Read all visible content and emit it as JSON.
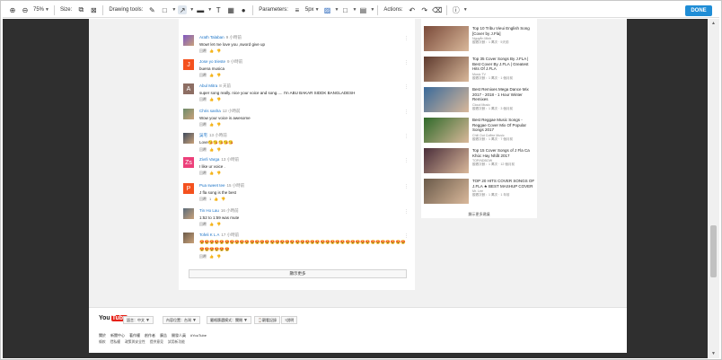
{
  "toolbar": {
    "zoom": "75%",
    "size_label": "Size:",
    "drawing_label": "Drawing tools:",
    "params_label": "Parameters:",
    "stroke": "5px",
    "actions_label": "Actions:",
    "done": "DONE"
  },
  "comments": [
    {
      "name": "Arath Talaban",
      "time": "9 小時前",
      "text": "Wow! let me love you ,sword give up",
      "avatar_color": "#7e57c2",
      "avatar_letter": "",
      "photo": true
    },
    {
      "name": "Jose yo trieste",
      "time": "9 小時前",
      "text": "buena musica",
      "avatar_color": "#f4511e",
      "avatar_letter": "J",
      "photo": false
    },
    {
      "name": "Abul Mitra",
      "time": "8 天前",
      "text": "super song really. nice your voice and song..... I'm ABU BAKAR SIDDK BANGLADESH",
      "avatar_color": "#8d6e63",
      "avatar_letter": "A",
      "photo": false
    },
    {
      "name": "Chris sasha",
      "time": "12 小時前",
      "text": "Wow your voice is awesome",
      "avatar_color": "#6d8b6a",
      "avatar_letter": "",
      "photo": true
    },
    {
      "name": "吳宅",
      "time": "13 小時前",
      "text": "Love😘😘😘😘😘",
      "avatar_color": "#3e4a5c",
      "avatar_letter": "",
      "photo": true
    },
    {
      "name": "Zivrli Varga",
      "time": "13 小時前",
      "text": "I like ur voice .",
      "avatar_color": "#ec407a",
      "avatar_letter": "Zs",
      "photo": false
    },
    {
      "name": "Pua sweet tee",
      "time": "15 小時前",
      "text": "J fla song is the best",
      "avatar_color": "#f4511e",
      "avatar_letter": "P",
      "photo": false
    },
    {
      "name": "Tin Ho Lau",
      "time": "16 小時前",
      "text": "1:52 to 1:59 was mute",
      "avatar_color": "#5a6b7a",
      "avatar_letter": "",
      "photo": true
    },
    {
      "name": "Tofeli K L A",
      "time": "17 小時前",
      "text": "😍😍😍😍😍😍😍😍😍😍😍😍😍😍😍😍😍😍😍😍😍😍😍😍😍😍😍😍😍😍😍😍😍😍😍😍😍😍😍😍😍😍😍😍😍😍😍😍😍",
      "text2": "😍😍😍😍😍😍",
      "avatar_color": "#6b5a4a",
      "avatar_letter": "",
      "photo": true
    }
  ],
  "comment_actions": {
    "reply": "回覆",
    "like_count": "1"
  },
  "more_comments": "顯示更多",
  "related": [
    {
      "title": "Top 10 Tribu Vieui English Song [Cover by J.Fla]",
      "channel": "Nguyễn Minh",
      "views": "觀看次數：1 萬次 · 5天前",
      "thumb": "#7a4a3a"
    },
    {
      "title": "Top 35 Cover Songs By J.FLA | Best Cover By J.FLA | Greatest Hits Of J.FLA",
      "channel": "Music TV",
      "views": "觀看次數：1 萬次 · 1 個月前",
      "thumb": "#5e3a2e"
    },
    {
      "title": "Best Remixes Mega Dance Mix 2017 - 2018 - 1 Hour Winter Remixes",
      "channel": "Cloud Music",
      "views": "觀看次數：1 萬次 · 3 個月前",
      "thumb": "#3a6a9a"
    },
    {
      "title": "Best Reggae Music Songs - Reggae Cover Mix Of Popular Songs 2017",
      "channel": "Chill Out Coffee Music",
      "views": "觀看次數：1 萬次 · 7 個月前",
      "thumb": "#2f6a2a"
    },
    {
      "title": "Top 15 Cover Songs of J Fla Ca Khúc Hay Nhất 2017",
      "channel": "TOP/NDBOW",
      "views": "觀看次數：1 萬次 · 12 個月前",
      "thumb": "#4a2e3a"
    },
    {
      "title": "TOP 20 HITS COVER SONGS OF J.FLA ★ BEST MASHUP COVER",
      "channel": "Mr. Lee",
      "views": "觀看次數：1 萬次 · 1 年前",
      "thumb": "#6a5a4a"
    }
  ],
  "related_more": "顯示更多建議",
  "footer": {
    "logo_you": "You",
    "logo_tube": "Tube",
    "language": "語言：中文",
    "location": "內容位置：台灣",
    "restricted": "嚴格篩選模式：關閉",
    "history": "觀看記錄",
    "help": "說明",
    "links1": [
      "關於",
      "新聞中心",
      "著作權",
      "創作者",
      "廣告",
      "開發人員",
      "#YouTube"
    ],
    "links2": [
      "條款",
      "隱私權",
      "政策與安全性",
      "提供意見",
      "試用新功能"
    ]
  }
}
